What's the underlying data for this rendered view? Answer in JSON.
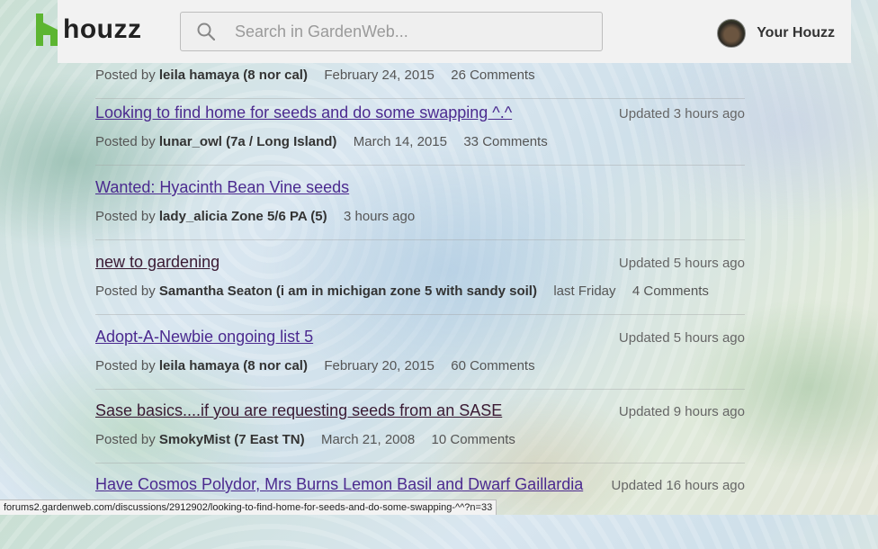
{
  "header": {
    "logo_text": "houzz",
    "search_placeholder": "Search in GardenWeb...",
    "user_label": "Your Houzz"
  },
  "threads": [
    {
      "title": "",
      "updated": "",
      "posted_by": "Posted by",
      "author": "leila hamaya (8 nor cal)",
      "date": "February 24, 2015",
      "comments": "26 Comments"
    },
    {
      "title": "Looking to find home for seeds and do some swapping ^.^",
      "updated": "Updated 3 hours ago",
      "posted_by": "Posted by",
      "author": "lunar_owl (7a / Long Island)",
      "date": "March 14, 2015",
      "comments": "33 Comments"
    },
    {
      "title": "Wanted: Hyacinth Bean Vine seeds",
      "updated": "",
      "posted_by": "Posted by",
      "author": "lady_alicia Zone 5/6 PA (5)",
      "date": "3 hours ago",
      "comments": ""
    },
    {
      "title": "new to gardening",
      "updated": "Updated 5 hours ago",
      "posted_by": "Posted by",
      "author": "Samantha Seaton (i am in michigan zone 5 with sandy soil)",
      "date": "last Friday",
      "comments": "4 Comments"
    },
    {
      "title": "Adopt-A-Newbie ongoing list 5",
      "updated": "Updated 5 hours ago",
      "posted_by": "Posted by",
      "author": "leila hamaya (8 nor cal)",
      "date": "February 20, 2015",
      "comments": "60 Comments"
    },
    {
      "title": "Sase basics....if you are requesting seeds from an SASE",
      "updated": "Updated 9 hours ago",
      "posted_by": "Posted by",
      "author": "SmokyMist (7 East TN)",
      "date": "March 21, 2008",
      "comments": "10 Comments"
    },
    {
      "title": "Have Cosmos Polydor, Mrs Burns Lemon Basil and Dwarf Gaillardia",
      "updated": "Updated 16 hours ago",
      "posted_by": "",
      "author": "",
      "date": "",
      "comments": ""
    }
  ],
  "status_bar": "forums2.gardenweb.com/discussions/2912902/looking-to-find-home-for-seeds-and-do-some-swapping-^^?n=33",
  "colors": {
    "link": "#4b2a8f",
    "link_visited": "#3a1a33",
    "header_bg": "#f2f2f2",
    "logo_green": "#5cb531"
  },
  "icons": [
    "houzz-logo-icon",
    "search-icon",
    "avatar"
  ]
}
